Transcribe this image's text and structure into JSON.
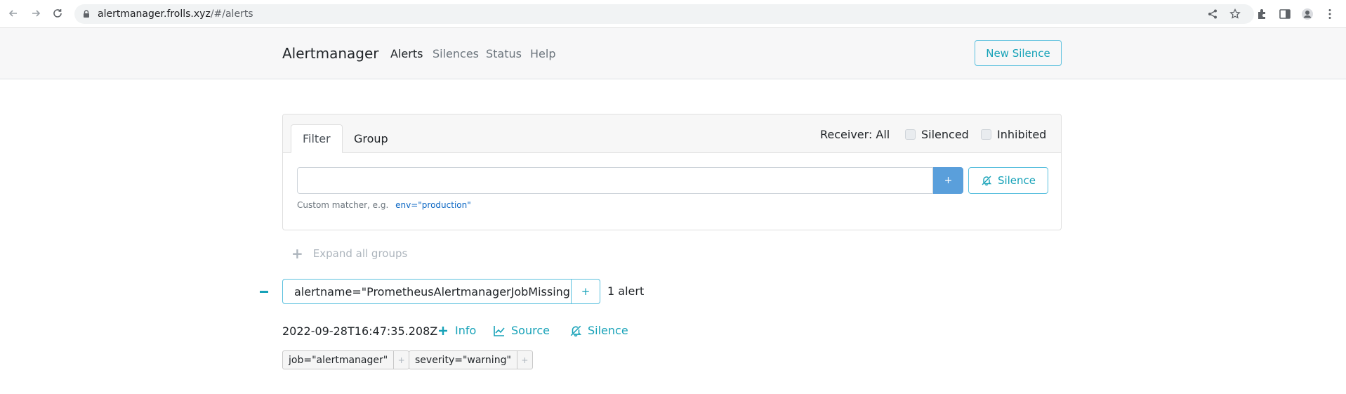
{
  "browser": {
    "url_host": "alertmanager.frolls.xyz",
    "url_path": "/#/alerts",
    "icons": [
      "back-icon",
      "forward-icon",
      "reload-icon",
      "lock-icon",
      "share-icon",
      "star-icon",
      "extensions-icon",
      "side-panel-icon",
      "profile-icon",
      "menu-icon"
    ]
  },
  "navbar": {
    "brand": "Alertmanager",
    "links": [
      {
        "label": "Alerts",
        "active": true
      },
      {
        "label": "Silences",
        "active": false
      },
      {
        "label": "Status",
        "active": false
      },
      {
        "label": "Help",
        "active": false
      }
    ],
    "new_silence_label": "New Silence"
  },
  "filter_card": {
    "tabs": [
      {
        "label": "Filter",
        "active": true
      },
      {
        "label": "Group",
        "active": false
      }
    ],
    "receiver_label": "Receiver: All",
    "silenced_label": "Silenced",
    "inhibited_label": "Inhibited",
    "input_value": "",
    "plus_label": "+",
    "silence_label": "Silence",
    "hint_text": "Custom matcher, e.g.",
    "hint_example": "env=\"production\""
  },
  "expand_all": {
    "icon": "+",
    "label": "Expand all groups"
  },
  "alert_group": {
    "collapse_symbol": "−",
    "label": "alertname=\"PrometheusAlertmanagerJobMissing\"",
    "plus_label": "+",
    "count_text": "1 alert",
    "alerts": [
      {
        "timestamp": "2022-09-28T16:47:35.208Z",
        "info_label": "Info",
        "source_label": "Source",
        "silence_label": "Silence",
        "labels": [
          {
            "text": "job=\"alertmanager\"",
            "add": "+"
          },
          {
            "text": "severity=\"warning\"",
            "add": "+"
          }
        ]
      }
    ]
  },
  "colors": {
    "accent": "#17a2b8",
    "accent_border": "#5bc0de",
    "primary_button": "#5a9fdb",
    "link": "#0b67c4",
    "navbar_bg": "#f7f7f8"
  }
}
